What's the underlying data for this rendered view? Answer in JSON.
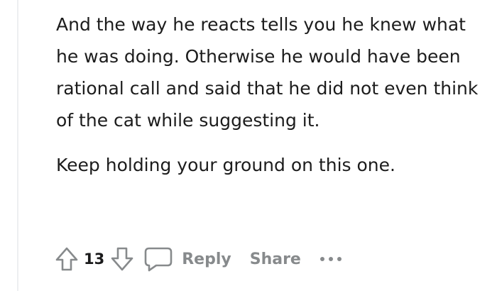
{
  "comment": {
    "paragraphs": [
      "And the way he reacts tells you he knew what he was doing. Otherwise he would have been rational call and said that he did not even think of the cat while suggesting it.",
      "Keep holding your ground on this one."
    ]
  },
  "actions": {
    "vote_count": "13",
    "reply_label": "Reply",
    "share_label": "Share"
  },
  "icons": {
    "upvote": "upvote-arrow-icon",
    "downvote": "downvote-arrow-icon",
    "reply": "speech-bubble-icon",
    "more": "ellipsis-icon"
  },
  "colors": {
    "text": "#1c1c1c",
    "meta": "#878a8c",
    "vote_count": "#1a1a1b",
    "thread_line": "#edeff1"
  }
}
